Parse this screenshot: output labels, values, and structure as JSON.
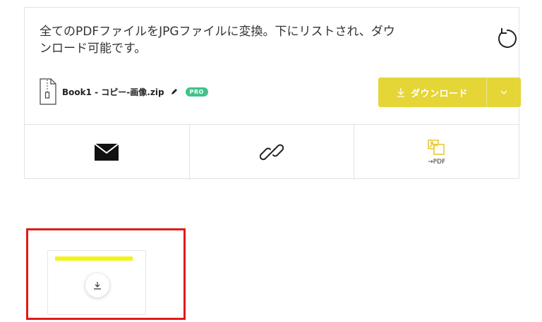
{
  "message": {
    "line1": "全てのPDFファイルをJPGファイルに変換。下にリストされ、ダウ",
    "line2": "ンロード可能です。"
  },
  "file": {
    "name": "Book1 - コピー-画像.zip",
    "badge": "PRO",
    "icon": "zip-file-icon"
  },
  "download": {
    "label": "ダウンロード",
    "icon": "download-icon",
    "caret_icon": "chevron-down-icon"
  },
  "actions": [
    {
      "icon": "mail-icon",
      "label": ""
    },
    {
      "icon": "link-icon",
      "label": ""
    },
    {
      "icon": "image-to-pdf-icon",
      "label": "→PDF"
    }
  ],
  "thumbnail": {
    "icon": "download-icon"
  },
  "colors": {
    "accent": "#e5d537",
    "pro_badge": "#3ec38a",
    "highlight": "#e01a1a",
    "icon_yellow": "#e5c72a"
  }
}
